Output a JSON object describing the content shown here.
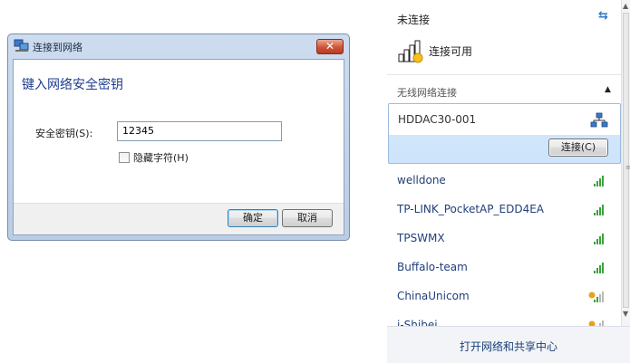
{
  "dialog": {
    "title": "连接到网络",
    "close_glyph": "✕",
    "heading": "键入网络安全密钥",
    "key_label": "安全密钥(S):",
    "key_value": "12345",
    "hide_chars_label": "隐藏字符(H)",
    "hide_chars_checked": false,
    "ok_label": "确定",
    "cancel_label": "取消"
  },
  "panel": {
    "status": "未连接",
    "available_text": "连接可用",
    "section_title": "无线网络连接",
    "selected_network": {
      "name": "HDDAC30-001",
      "connect_label": "连接(C)"
    },
    "networks": [
      {
        "name": "welldone",
        "secured": false
      },
      {
        "name": "TP-LINK_PocketAP_EDD4EA",
        "secured": false
      },
      {
        "name": "TPSWMX",
        "secured": false
      },
      {
        "name": "Buffalo-team",
        "secured": false
      },
      {
        "name": "ChinaUnicom",
        "secured": true
      },
      {
        "name": "i-Shibei",
        "secured": true
      }
    ],
    "footer_link": "打开网络和共享中心"
  },
  "colors": {
    "accent": "#1f3d8f",
    "link": "#22407a",
    "selection": "#cde4fb",
    "signal": "#3aa33a",
    "warning": "#e8a317"
  }
}
